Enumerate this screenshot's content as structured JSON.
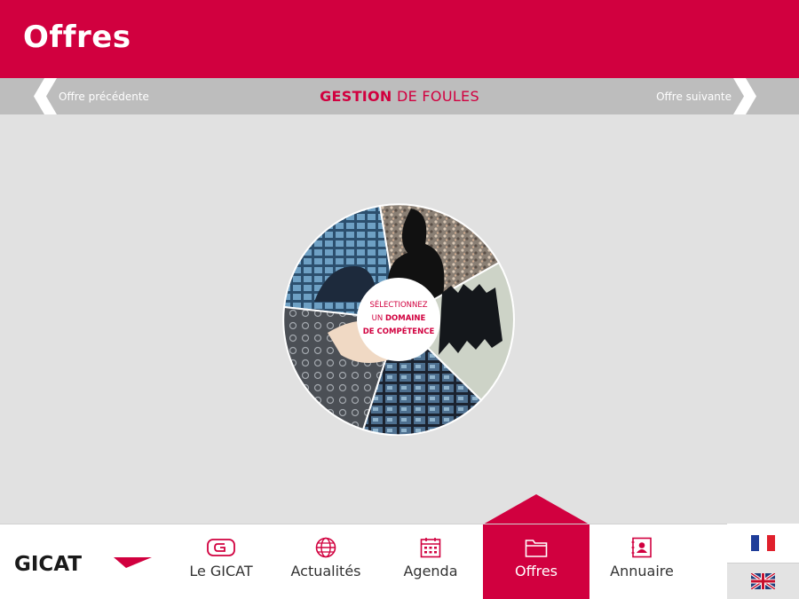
{
  "header": {
    "title": "Offres"
  },
  "subnav": {
    "prev_label": "Offre précédente",
    "next_label": "Offre suivante",
    "title_bold": "GESTION",
    "title_rest": " DE FOULES"
  },
  "wheel": {
    "center_line1": "SÉLECTIONNEZ",
    "center_line2a": "UN ",
    "center_line2b": "DOMAINE",
    "center_line3": "DE COMPÉTENCE",
    "segments": [
      "control-room-operator",
      "crowd-surveillance",
      "riot-police",
      "monitor-wall",
      "touch-interface"
    ]
  },
  "footer": {
    "logo_text": "GICAT",
    "nav": [
      {
        "label": "Le GICAT",
        "icon": "gicat-logo-icon"
      },
      {
        "label": "Actualités",
        "icon": "globe-icon"
      },
      {
        "label": "Agenda",
        "icon": "calendar-icon"
      },
      {
        "label": "Offres",
        "icon": "folder-icon",
        "active": true
      },
      {
        "label": "Annuaire",
        "icon": "contact-book-icon"
      }
    ],
    "languages": [
      "french-flag-icon",
      "uk-flag-icon"
    ]
  },
  "colors": {
    "brand": "#d1003f",
    "subbar": "#bdbdbd",
    "background": "#e1e1e1"
  }
}
